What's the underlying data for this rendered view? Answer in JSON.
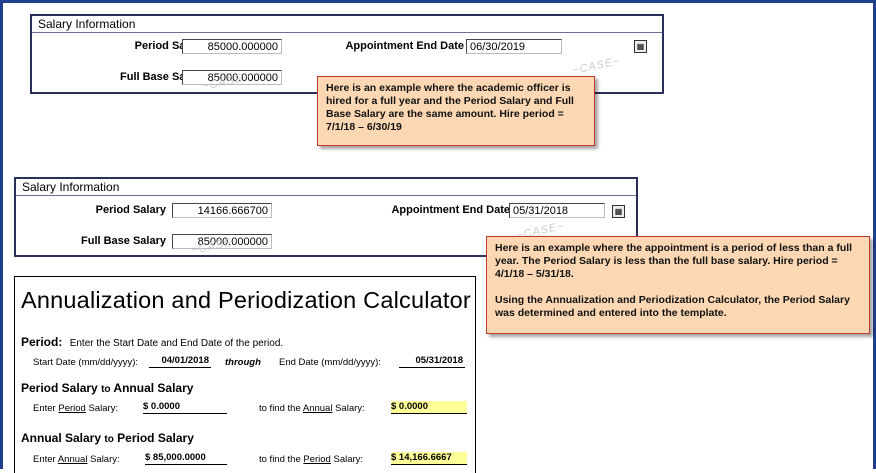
{
  "panel1": {
    "header": "Salary Information",
    "period_salary_label": "Period Salary",
    "period_salary_value": "85000.000000",
    "full_base_label": "Full Base Salary",
    "full_base_value": "85000.000000",
    "end_date_label": "Appointment End Date",
    "end_date_value": "06/30/2019"
  },
  "note1": "Here is an example where the academic officer is hired for a full year and the Period Salary and Full Base Salary are the same amount.  Hire period = 7/1/18 – 6/30/19",
  "panel2": {
    "header": "Salary Information",
    "period_salary_label": "Period Salary",
    "period_salary_value": "14166.666700",
    "full_base_label": "Full Base Salary",
    "full_base_value": "85000.000000",
    "end_date_label": "Appointment End Date",
    "end_date_value": "05/31/2018"
  },
  "note2": {
    "p1": "Here is an example where the appointment is a period of less than a full year.  The Period Salary is less than the full base salary.  Hire period = 4/1/18 – 5/31/18.",
    "p2": "Using the Annualization and Periodization Calculator, the Period Salary was determined and entered into the template."
  },
  "calculator": {
    "title": "Annualization and Periodization Calculator",
    "period_heading": "Period:",
    "period_instruction": "Enter the Start Date and End Date of the period.",
    "start_label": "Start Date (mm/dd/yyyy):",
    "start_value": "04/01/2018",
    "through": "through",
    "end_label": "End Date (mm/dd/yyyy):",
    "end_value": "05/31/2018",
    "p2a_heading_a": "Period Salary",
    "p2a_heading_to": "to",
    "p2a_heading_b": "Annual Salary",
    "p2a_enter_prefix": "Enter",
    "p2a_enter_link": "Period",
    "p2a_enter_suffix": "Salary:",
    "p2a_enter_value": "$ 0.0000",
    "p2a_find_prefix": "to find the",
    "p2a_find_link": "Annual",
    "p2a_find_suffix": "Salary:",
    "p2a_find_value": "$ 0.0000",
    "a2p_heading_a": "Annual Salary",
    "a2p_heading_to": "to",
    "a2p_heading_b": "Period Salary",
    "a2p_enter_prefix": "Enter",
    "a2p_enter_link": "Annual",
    "a2p_enter_suffix": "Salary:",
    "a2p_enter_value": "$ 85,000.0000",
    "a2p_find_prefix": "to find the",
    "a2p_find_link": "Period",
    "a2p_find_suffix": "Salary:",
    "a2p_find_value": "$ 14,166.6667"
  }
}
